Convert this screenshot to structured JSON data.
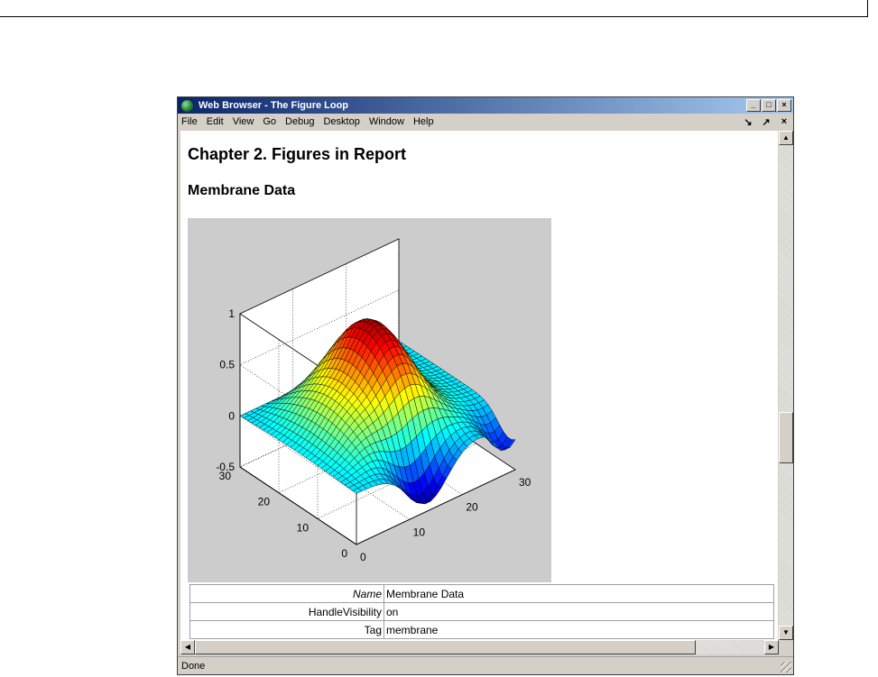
{
  "window": {
    "title": "Web Browser - The Figure Loop",
    "min_glyph": "_",
    "max_glyph": "□",
    "close_glyph": "×"
  },
  "menu": {
    "items": [
      "File",
      "Edit",
      "View",
      "Go",
      "Debug",
      "Desktop",
      "Window",
      "Help"
    ],
    "dock_glyph": "↘",
    "undock_glyph": "↗",
    "close_glyph": "×"
  },
  "content": {
    "chapter_title": "Chapter 2. Figures in Report",
    "section_title": "Membrane Data"
  },
  "chart_data": {
    "type": "surface",
    "z_ticks": [
      "1",
      "0.5",
      "0",
      "-0.5"
    ],
    "y_ticks": [
      "30",
      "20",
      "10",
      "0"
    ],
    "x_ticks": [
      "0",
      "10",
      "20",
      "30"
    ],
    "zlim": [
      -0.5,
      1
    ],
    "xlim": [
      0,
      30
    ],
    "ylim": [
      0,
      30
    ],
    "grid": true,
    "colormap": "jet"
  },
  "properties": [
    {
      "key": "Name",
      "value": "Membrane Data"
    },
    {
      "key": "HandleVisibility",
      "value": "on"
    },
    {
      "key": "Tag",
      "value": "membrane"
    }
  ],
  "status": {
    "text": "Done"
  }
}
